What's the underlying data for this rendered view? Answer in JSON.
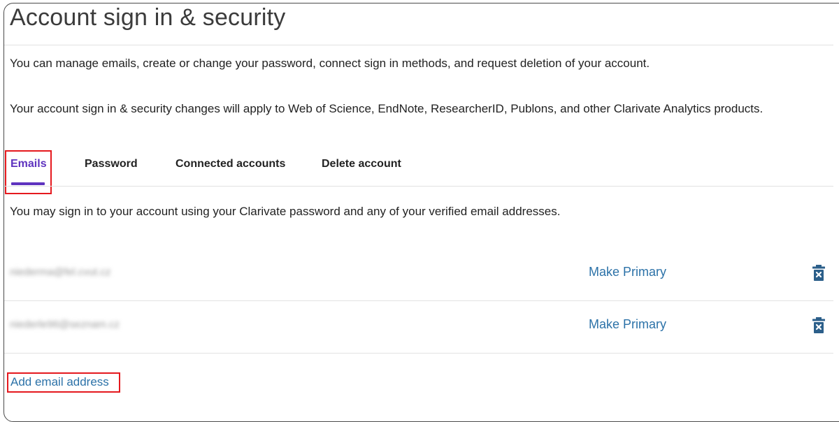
{
  "page": {
    "title": "Account sign in & security",
    "intro_line_1": "You can manage emails, create or change your password, connect sign in methods, and request deletion of your account.",
    "intro_line_2": "Your account sign in & security changes will apply to Web of Science, EndNote, ResearcherID, Publons, and other Clarivate Analytics products."
  },
  "tabs": [
    {
      "label": "Emails",
      "active": true
    },
    {
      "label": "Password",
      "active": false
    },
    {
      "label": "Connected accounts",
      "active": false
    },
    {
      "label": "Delete account",
      "active": false
    }
  ],
  "emails_panel": {
    "description": "You may sign in to your account using your Clarivate password and any of your verified email addresses.",
    "emails": [
      {
        "address": "niederma@fel.cvut.cz",
        "action_label": "Make Primary",
        "delete_icon": "trash-icon"
      },
      {
        "address": "niederle96@seznam.cz",
        "action_label": "Make Primary",
        "delete_icon": "trash-icon"
      }
    ],
    "add_email_label": "Add email address"
  },
  "colors": {
    "accent": "#5e33bf",
    "link": "#2c72a8",
    "highlight": "#e5191e",
    "icon": "#2c5f8a"
  }
}
